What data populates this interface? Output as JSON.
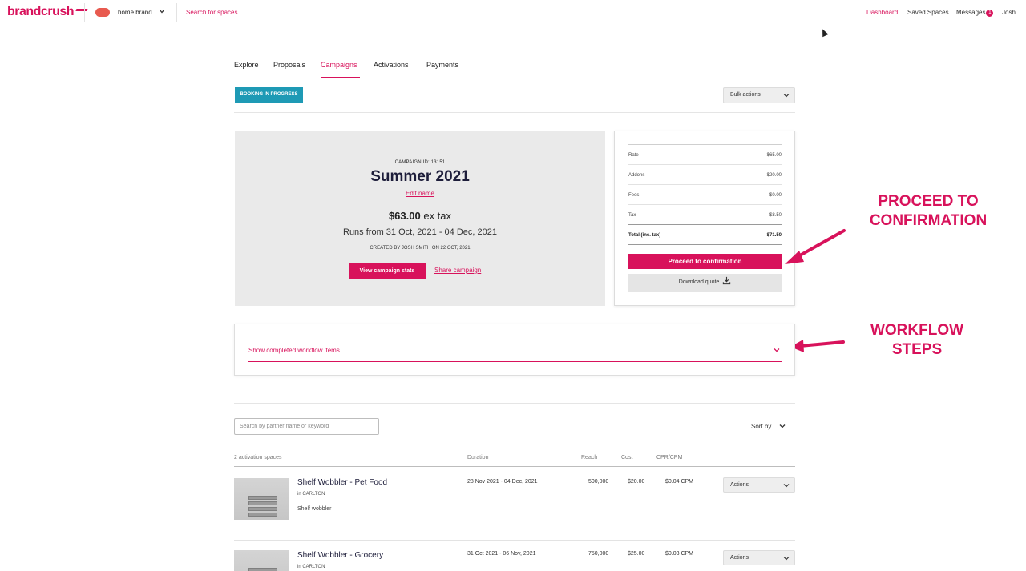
{
  "topnav": {
    "logo": "brandcrush",
    "brand_name": "home brand",
    "search_link": "Search for spaces",
    "dashboard": "Dashboard",
    "saved_spaces": "Saved Spaces",
    "messages": "Messages",
    "messages_count": "1",
    "user": "Josh"
  },
  "tabs": [
    "Explore",
    "Proposals",
    "Campaigns",
    "Activations",
    "Payments"
  ],
  "active_tab": "Campaigns",
  "status_badge": "BOOKING IN PROGRESS",
  "bulk_actions": "Bulk actions",
  "campaign": {
    "id_label": "CAMPAIGN ID: 13151",
    "title": "Summer 2021",
    "edit_name": "Edit name",
    "price": "$63.00",
    "price_suffix": "ex tax",
    "runs": "Runs from 31 Oct, 2021 - 04 Dec, 2021",
    "created": "CREATED BY JOSH SMITH ON 22 OCT, 2021",
    "view_stats": "View campaign stats",
    "share": "Share campaign"
  },
  "quote": {
    "rows": [
      {
        "label": "Rate",
        "value": "$65.00"
      },
      {
        "label": "Addons",
        "value": "$20.00"
      },
      {
        "label": "Fees",
        "value": "$0.00"
      },
      {
        "label": "Tax",
        "value": "$8.50"
      },
      {
        "label": "Total (inc. tax)",
        "value": "$71.50"
      }
    ],
    "proceed": "Proceed to confirmation",
    "download": "Download quote"
  },
  "annotations": {
    "proceed_line1": "PROCEED TO",
    "proceed_line2": "CONFIRMATION",
    "workflow_line1": "WORKFLOW",
    "workflow_line2": "STEPS"
  },
  "workflow": {
    "label": "Show completed workflow items"
  },
  "search": {
    "placeholder": "Search by partner name or keyword"
  },
  "sort_by": "Sort by",
  "table": {
    "headers": {
      "spaces": "2 activation spaces",
      "duration": "Duration",
      "reach": "Reach",
      "cost": "Cost",
      "cpr": "CPR/CPM"
    },
    "rows": [
      {
        "title": "Shelf Wobbler - Pet Food",
        "location": "in CARLTON",
        "desc": "Shelf wobbler",
        "duration": "28 Nov 2021 - 04 Dec, 2021",
        "reach": "500,000",
        "cost": "$20.00",
        "cpr": "$0.04 CPM",
        "actions": "Actions"
      },
      {
        "title": "Shelf Wobbler - Grocery",
        "location": "in CARLTON",
        "desc": "",
        "duration": "31 Oct 2021 - 06 Nov, 2021",
        "reach": "750,000",
        "cost": "$25.00",
        "cpr": "$0.03 CPM",
        "actions": "Actions"
      }
    ]
  },
  "colors": {
    "brand": "#d8125b",
    "badge": "#1e9ab5",
    "panel_bg": "#eaeaea"
  }
}
